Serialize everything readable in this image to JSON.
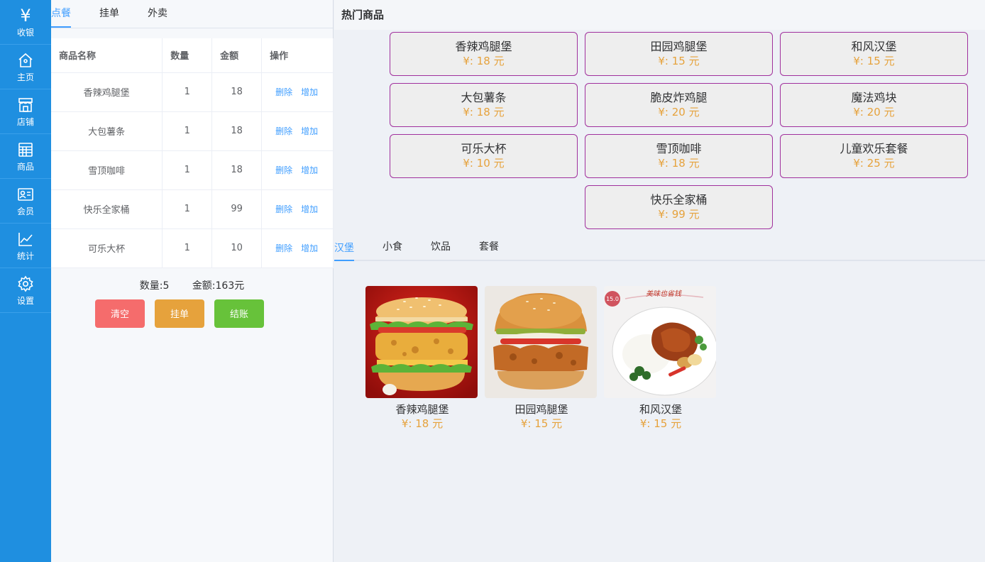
{
  "sidebar": {
    "items": [
      {
        "label": "收银",
        "icon": "yen-icon"
      },
      {
        "label": "主页",
        "icon": "home-icon"
      },
      {
        "label": "店铺",
        "icon": "store-icon"
      },
      {
        "label": "商品",
        "icon": "list-icon"
      },
      {
        "label": "会员",
        "icon": "member-card-icon"
      },
      {
        "label": "统计",
        "icon": "chart-icon"
      },
      {
        "label": "设置",
        "icon": "gear-icon"
      }
    ]
  },
  "order_tabs": [
    "点餐",
    "挂单",
    "外卖"
  ],
  "order_table": {
    "headers": [
      "商品名称",
      "数量",
      "金额",
      "操作"
    ],
    "delete_label": "删除",
    "add_label": "增加",
    "rows": [
      {
        "name": "香辣鸡腿堡",
        "qty": "1",
        "amount": "18"
      },
      {
        "name": "大包薯条",
        "qty": "1",
        "amount": "18"
      },
      {
        "name": "雪顶咖啡",
        "qty": "1",
        "amount": "18"
      },
      {
        "name": "快乐全家桶",
        "qty": "1",
        "amount": "99"
      },
      {
        "name": "可乐大杯",
        "qty": "1",
        "amount": "10"
      }
    ]
  },
  "summary": {
    "quantity": "数量:5",
    "total": "金额:163元"
  },
  "actions": {
    "clear": "清空",
    "hold": "挂单",
    "checkout": "结账"
  },
  "hot": {
    "title": "热门商品",
    "items": [
      {
        "name": "香辣鸡腿堡",
        "price": "¥: 18 元"
      },
      {
        "name": "田园鸡腿堡",
        "price": "¥: 15 元"
      },
      {
        "name": "和风汉堡",
        "price": "¥: 15 元"
      },
      {
        "name": "大包薯条",
        "price": "¥: 18 元"
      },
      {
        "name": "脆皮炸鸡腿",
        "price": "¥: 20 元"
      },
      {
        "name": "魔法鸡块",
        "price": "¥: 20 元"
      },
      {
        "name": "可乐大杯",
        "price": "¥: 10 元"
      },
      {
        "name": "雪顶咖啡",
        "price": "¥: 18 元"
      },
      {
        "name": "儿童欢乐套餐",
        "price": "¥: 25 元"
      },
      {
        "name": "快乐全家桶",
        "price": "¥: 99 元"
      }
    ]
  },
  "category_tabs": [
    "汉堡",
    "小食",
    "饮品",
    "套餐"
  ],
  "goods": [
    {
      "name": "香辣鸡腿堡",
      "price": "¥: 18 元",
      "image": "spicy-chicken-burger-photo"
    },
    {
      "name": "田园鸡腿堡",
      "price": "¥: 15 元",
      "image": "garden-chicken-burger-photo"
    },
    {
      "name": "和风汉堡",
      "price": "¥: 15 元",
      "image": "japanese-style-burger-photo"
    }
  ],
  "goods_promo": {
    "badge": "15.0",
    "banner": "美味也省钱"
  },
  "colors": {
    "sidebar": "#1f8fe0",
    "accent": "#409eff",
    "price": "#e6a23c",
    "card_border": "#a0309d",
    "clear": "#f56c6c",
    "hold": "#e6a23c",
    "checkout": "#67c23a"
  }
}
